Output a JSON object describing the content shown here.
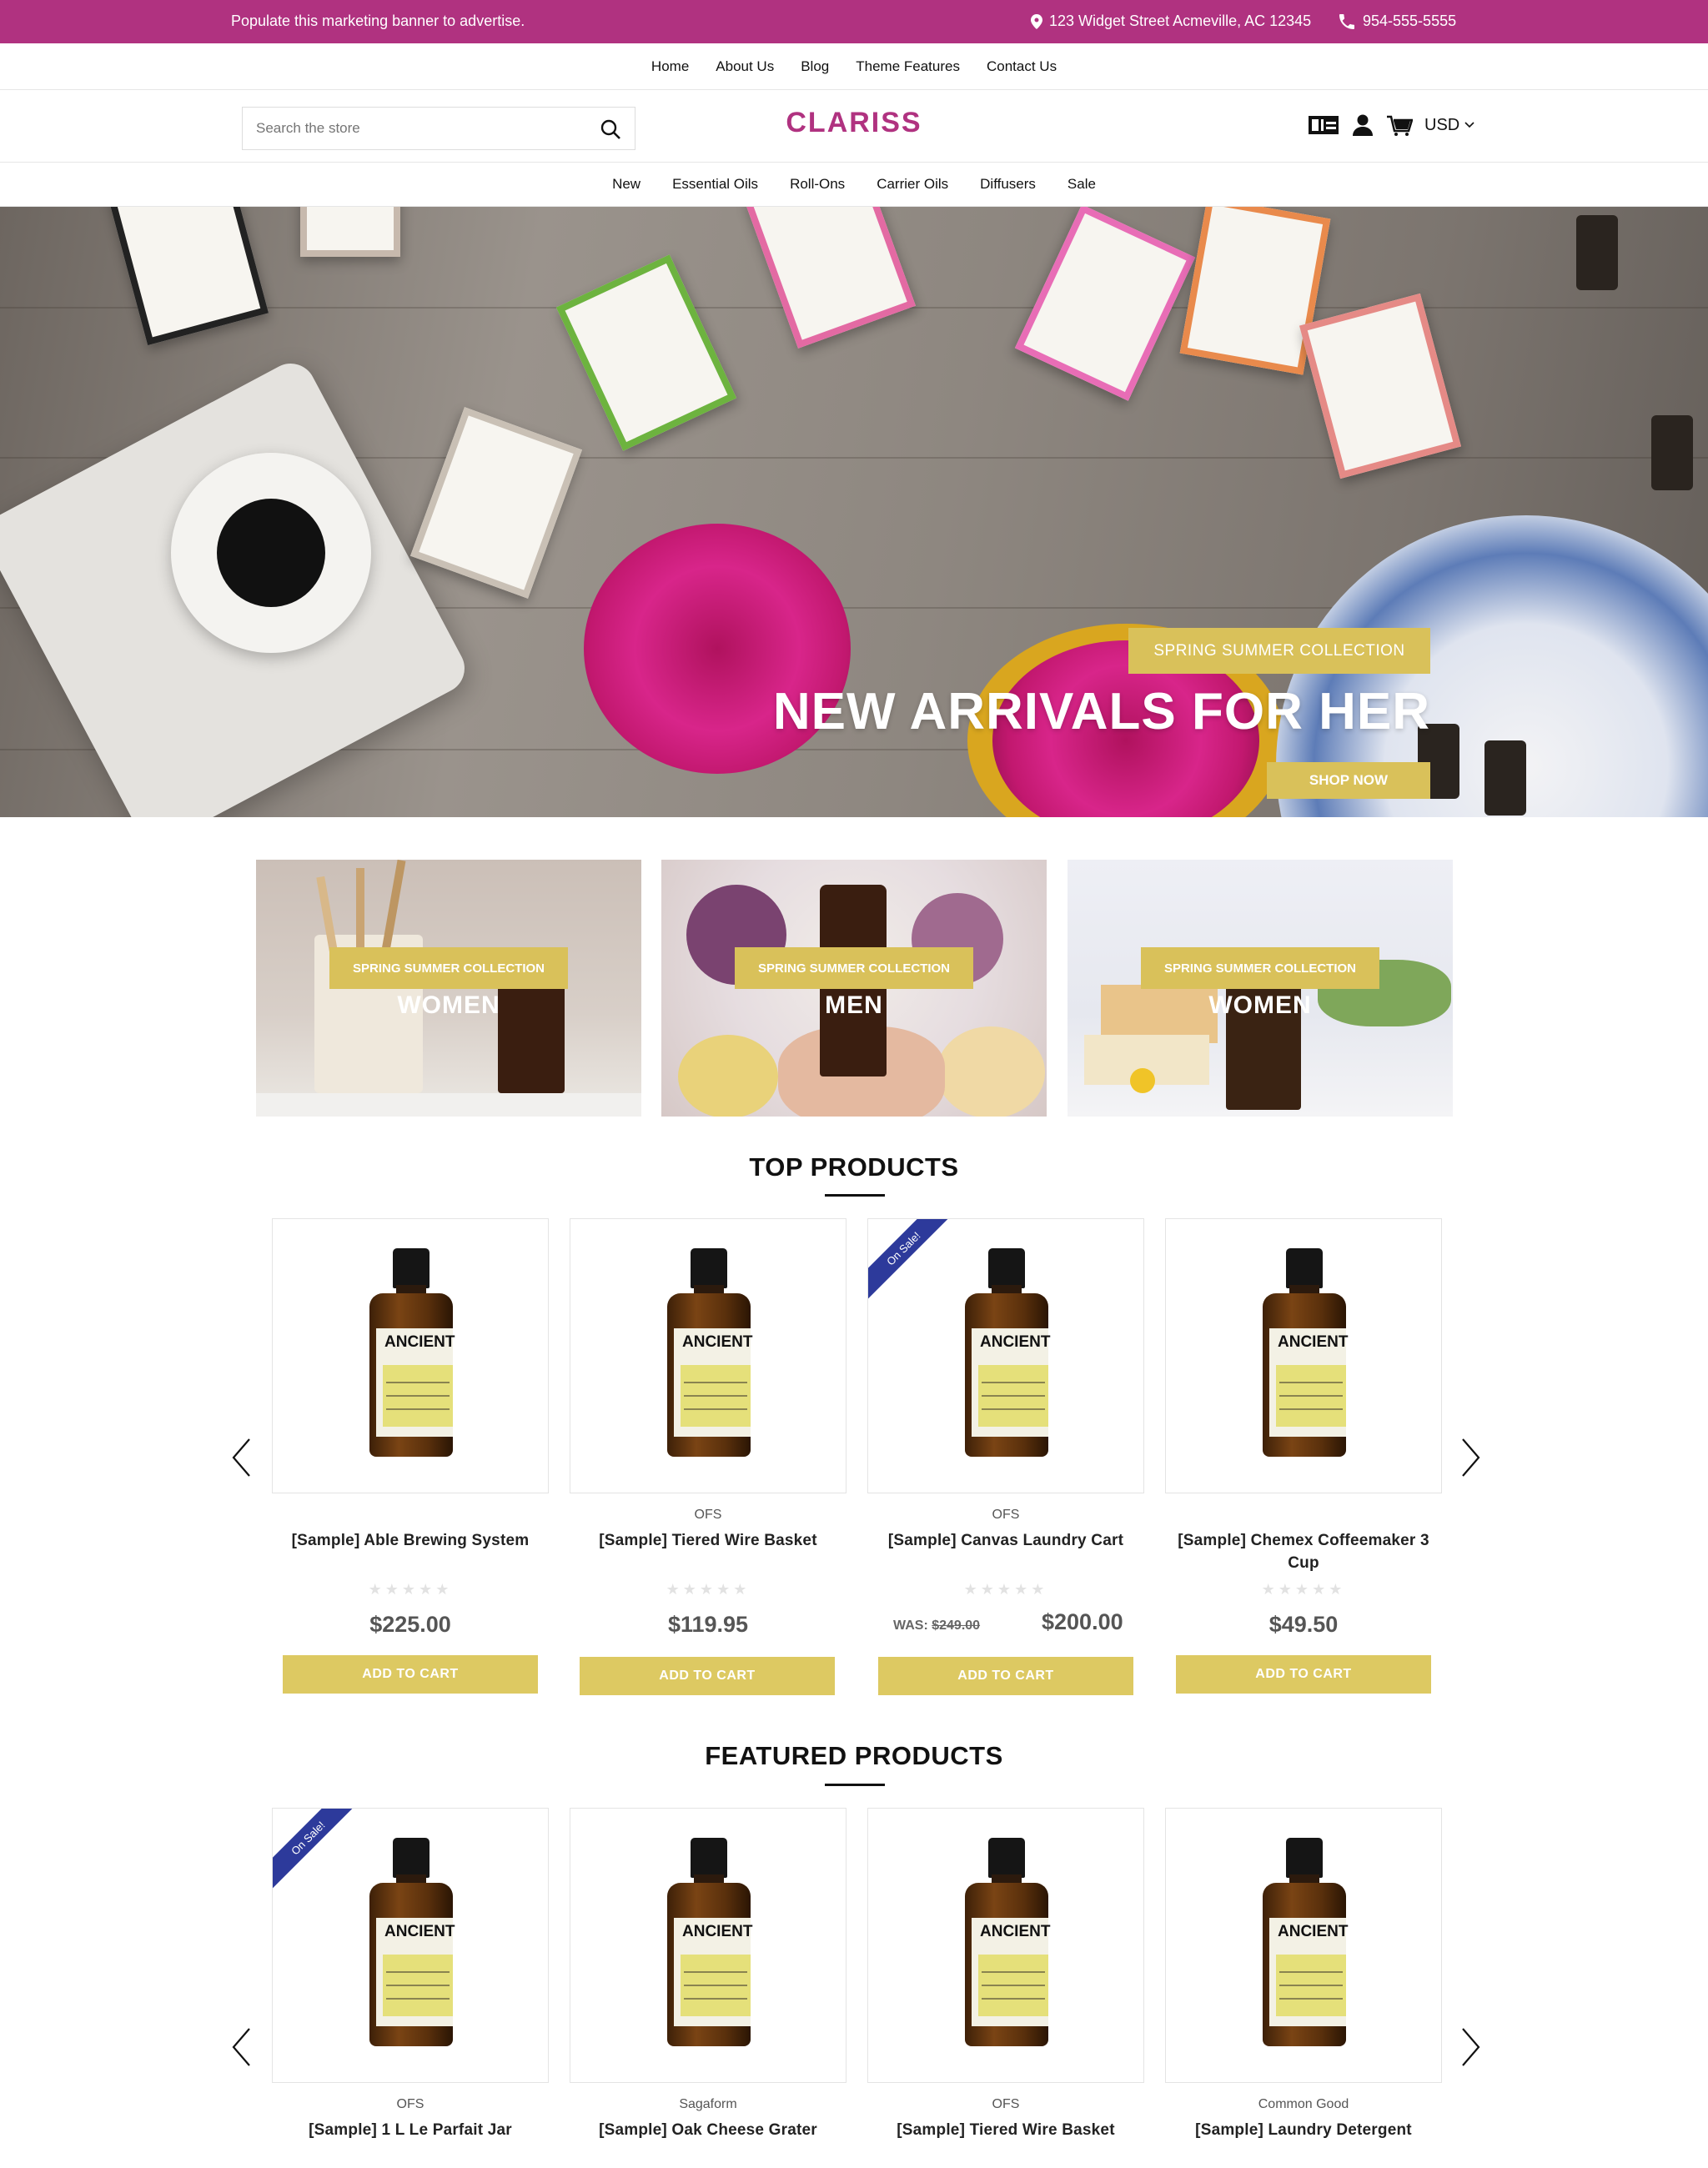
{
  "topbar": {
    "promo": "Populate this marketing banner to advertise.",
    "address": "123 Widget Street Acmeville, AC 12345",
    "phone": "954-555-5555",
    "bg_color": "#b03280"
  },
  "subnav": {
    "items": [
      "Home",
      "About Us",
      "Blog",
      "Theme Features",
      "Contact Us"
    ]
  },
  "header": {
    "search_placeholder": "Search the store",
    "logo": "CLARISS",
    "currency": "USD"
  },
  "mainnav": {
    "items": [
      "New",
      "Essential Oils",
      "Roll-Ons",
      "Carrier Oils",
      "Diffusers",
      "Sale"
    ]
  },
  "hero": {
    "tag": "SPRING SUMMER COLLECTION",
    "headline": "NEW ARRIVALS FOR HER",
    "cta": "SHOP NOW"
  },
  "collections": [
    {
      "tag": "SPRING SUMMER COLLECTION",
      "title": "WOMEN"
    },
    {
      "tag": "SPRING SUMMER COLLECTION",
      "title": "MEN"
    },
    {
      "tag": "SPRING SUMMER COLLECTION",
      "title": "WOMEN"
    }
  ],
  "product_image_label": {
    "brand_text": "ANCIENT",
    "ribbon": "On Sale!"
  },
  "top_products": {
    "title": "TOP PRODUCTS",
    "items": [
      {
        "brand": "",
        "name": "[Sample] Able Brewing System",
        "price": "$225.00",
        "was_label": "",
        "was": "",
        "on_sale": false,
        "cta": "ADD TO CART"
      },
      {
        "brand": "OFS",
        "name": "[Sample] Tiered Wire Basket",
        "price": "$119.95",
        "was_label": "",
        "was": "",
        "on_sale": false,
        "cta": "ADD TO CART"
      },
      {
        "brand": "OFS",
        "name": "[Sample] Canvas Laundry Cart",
        "price": "$200.00",
        "was_label": "WAS:",
        "was": "$249.00",
        "on_sale": true,
        "cta": "ADD TO CART"
      },
      {
        "brand": "",
        "name": "[Sample] Chemex Coffeemaker 3 Cup",
        "price": "$49.50",
        "was_label": "",
        "was": "",
        "on_sale": false,
        "cta": "ADD TO CART"
      }
    ]
  },
  "featured_products": {
    "title": "FEATURED PRODUCTS",
    "items": [
      {
        "brand": "OFS",
        "name": "[Sample] 1 L Le Parfait Jar",
        "on_sale": true
      },
      {
        "brand": "Sagaform",
        "name": "[Sample] Oak Cheese Grater",
        "on_sale": false
      },
      {
        "brand": "OFS",
        "name": "[Sample] Tiered Wire Basket",
        "on_sale": false
      },
      {
        "brand": "Common Good",
        "name": "[Sample] Laundry Detergent",
        "on_sale": false
      }
    ]
  },
  "colors": {
    "accent": "#b03280",
    "gold": "#d9c15a",
    "ribbon": "#2d3a9b"
  }
}
